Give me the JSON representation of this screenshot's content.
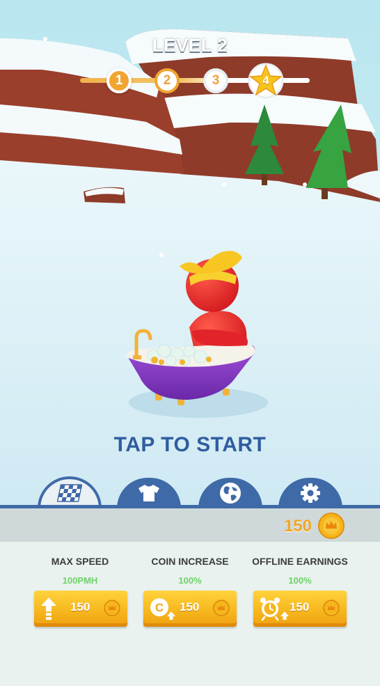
{
  "level": {
    "title": "LEVEL 2"
  },
  "progress": {
    "nodes": [
      {
        "label": "1",
        "state": "done"
      },
      {
        "label": "2",
        "state": "current"
      },
      {
        "label": "3",
        "state": "upcoming"
      },
      {
        "label": "4",
        "state": "boss-star"
      }
    ]
  },
  "prompt": {
    "tap_to_start": "TAP TO START"
  },
  "tabs": [
    {
      "name": "race-flag",
      "icon": "checkered-flag-icon",
      "active": true
    },
    {
      "name": "skins",
      "icon": "tshirt-icon",
      "active": false
    },
    {
      "name": "world",
      "icon": "globe-icon",
      "active": false
    },
    {
      "name": "settings",
      "icon": "gear-icon",
      "active": false
    }
  ],
  "wallet": {
    "coins": "150",
    "icon": "crown-coin-icon"
  },
  "upgrades": [
    {
      "title": "MAX SPEED",
      "value": "100PMH",
      "price": "150",
      "icon": "speed-up-arrow-icon"
    },
    {
      "title": "COIN INCREASE",
      "value": "100%",
      "price": "150",
      "icon": "coin-increase-icon"
    },
    {
      "title": "OFFLINE EARNINGS",
      "value": "100%",
      "price": "150",
      "icon": "alarm-clock-icon"
    }
  ],
  "colors": {
    "accent_blue": "#3f6aa8",
    "gold": "#f3a626",
    "value_green": "#6fd06a",
    "character_red": "#e8242a",
    "tub_purple": "#8a3cc4"
  }
}
